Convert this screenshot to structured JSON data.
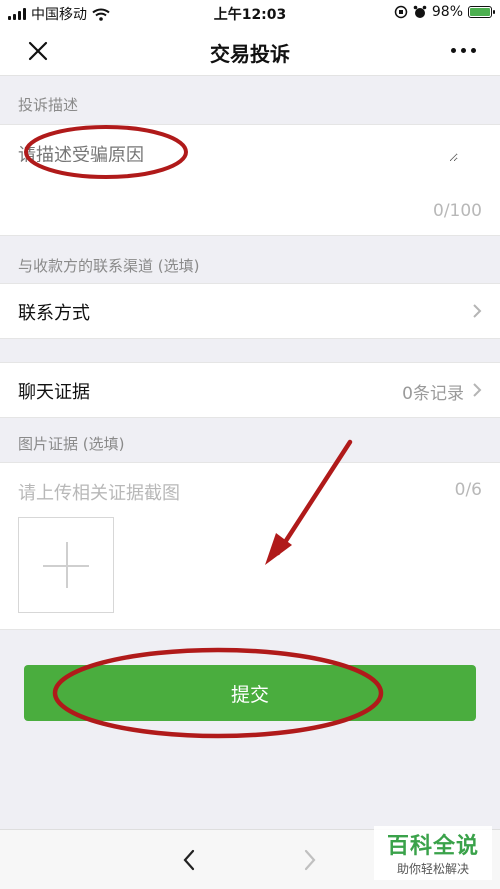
{
  "status_bar": {
    "carrier": "中国移动",
    "time": "上午12:03",
    "battery_percent": "98%",
    "battery_level": 0.98,
    "icons": [
      "signal-icon",
      "wifi-icon",
      "orientation-lock-icon",
      "alarm-icon",
      "battery-charging-icon"
    ]
  },
  "nav": {
    "title": "交易投诉",
    "close_icon": "close-icon",
    "more_icon": "more-icon"
  },
  "complaint_description": {
    "header": "投诉描述",
    "placeholder": "请描述受骗原因",
    "counter": "0/100"
  },
  "contact_section": {
    "header": "与收款方的联系渠道 (选填)",
    "label": "联系方式"
  },
  "chat_evidence": {
    "label": "聊天证据",
    "value": "0条记录"
  },
  "image_evidence": {
    "header": "图片证据 (选填)",
    "placeholder": "请上传相关证据截图",
    "counter": "0/6"
  },
  "submit": {
    "label": "提交",
    "color": "#4aad3e"
  },
  "annotations": {
    "color": "#b01a1a"
  },
  "watermark": {
    "main": "百科全说",
    "sub": "助你轻松解决"
  }
}
